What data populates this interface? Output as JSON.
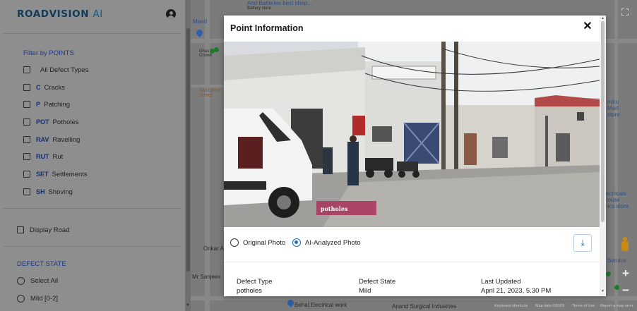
{
  "app": {
    "brand_main": "ROADVISION",
    "brand_ai": "AI"
  },
  "sidebar": {
    "filter_title": "Filter by POINTS",
    "point_filters": [
      {
        "code": "",
        "label": "All Defect Types"
      },
      {
        "code": "C",
        "label": "Cracks"
      },
      {
        "code": "P",
        "label": "Patching"
      },
      {
        "code": "POT",
        "label": "Potholes"
      },
      {
        "code": "RAV",
        "label": "Ravelling"
      },
      {
        "code": "RUT",
        "label": "Rut"
      },
      {
        "code": "SET",
        "label": "Settlements"
      },
      {
        "code": "SH",
        "label": "Shoving"
      }
    ],
    "display_road_label": "Display Road",
    "defect_state_title": "DEFECT STATE",
    "defect_state_options": [
      "Select All",
      "Mild [0-2]"
    ]
  },
  "map": {
    "labels": {
      "battery_store": "And Batteries best shop...",
      "battery_store_sub": "Battery store",
      "mand": "Mand",
      "ghas_chowk": "Ghas\nChowk",
      "sabhpur": "Sabhpore\nStreet",
      "onkar": "Onkar A",
      "mr_sanjeev": "Mr Sanjeev",
      "behal": "Behal Electrical work",
      "anand": "Anand Surgical Industries",
      "indru_mart": "ndru\nMart\nstore",
      "electricals": "lectricals\nhouse\nnics store",
      "service": "Service"
    },
    "footer": {
      "shortcuts": "Keyboard shortcuts",
      "map_data": "Map data ©2023",
      "terms": "Terms of Use",
      "report": "Report a map error"
    }
  },
  "modal": {
    "title": "Point Information",
    "photo_tag": "potholes",
    "photo_options": [
      {
        "label": "Original Photo",
        "selected": false
      },
      {
        "label": "AI-Analyzed Photo",
        "selected": true
      }
    ],
    "info": {
      "defect_type_label": "Defect Type",
      "defect_type_value": "potholes",
      "defect_state_label": "Defect State",
      "defect_state_value": "Mild",
      "last_updated_label": "Last Updated",
      "last_updated_value": "April 21, 2023, 5.30 PM"
    }
  },
  "icons": {
    "user": "user-circle-icon",
    "fullscreen": "fullscreen-icon",
    "close": "close-icon",
    "download": "download-icon",
    "zoom_in": "plus-icon",
    "zoom_out": "minus-icon",
    "street_view": "pegman-icon"
  },
  "colors": {
    "brand": "#0d3b5c",
    "accent": "#1c6fc0",
    "code_text": "#17306e",
    "section_title": "#1d3a8a",
    "photo_tag_bg": "#a8325a"
  }
}
